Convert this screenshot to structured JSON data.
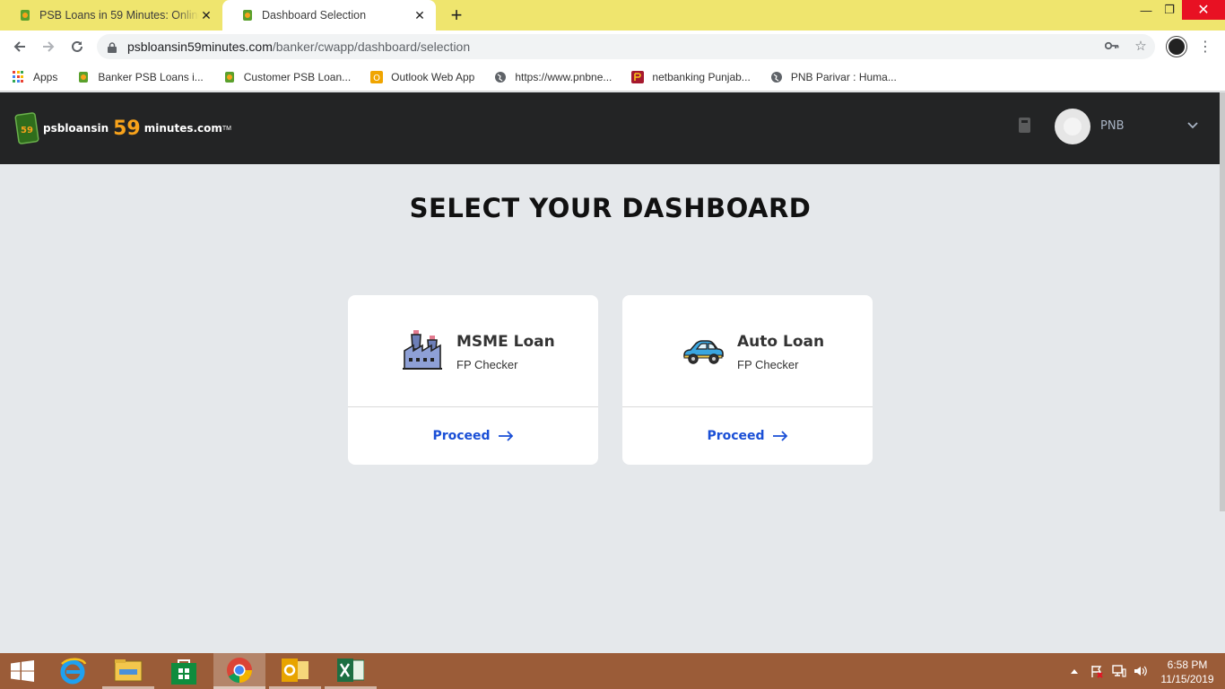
{
  "browser": {
    "tabs": [
      {
        "title": "PSB Loans in 59 Minutes: Online",
        "active": false
      },
      {
        "title": "Dashboard Selection",
        "active": true
      }
    ],
    "new_tab_label": "+",
    "address": {
      "host": "psbloansin59minutes.com",
      "path": "/banker/cwapp/dashboard/selection"
    },
    "bookmarks": [
      {
        "label": "Apps",
        "icon": "apps-grid-icon"
      },
      {
        "label": "Banker PSB Loans i...",
        "icon": "psb-favicon"
      },
      {
        "label": "Customer PSB Loan...",
        "icon": "psb-favicon"
      },
      {
        "label": "Outlook Web App",
        "icon": "outlook-icon"
      },
      {
        "label": "https://www.pnbne...",
        "icon": "globe-icon"
      },
      {
        "label": "netbanking Punjab...",
        "icon": "pnb-icon"
      },
      {
        "label": "PNB Parivar : Huma...",
        "icon": "globe-icon"
      }
    ]
  },
  "site": {
    "brand": {
      "part1": "psbloansin",
      "part2": "59",
      "part3": "minutes.com",
      "tm": "TM"
    },
    "user": {
      "name": "PNB"
    },
    "page_title": "SELECT YOUR DASHBOARD",
    "cards": [
      {
        "title": "MSME Loan",
        "subtitle": "FP Checker",
        "action": "Proceed",
        "icon": "factory-icon"
      },
      {
        "title": "Auto Loan",
        "subtitle": "FP Checker",
        "action": "Proceed",
        "icon": "car-icon"
      }
    ]
  },
  "taskbar": {
    "apps": [
      "internet-explorer-icon",
      "file-explorer-icon",
      "store-icon",
      "chrome-icon",
      "outlook-icon",
      "excel-icon"
    ],
    "clock": {
      "time": "6:58 PM",
      "date": "11/15/2019"
    }
  },
  "colors": {
    "tabstrip": "#efe56e",
    "site_header": "#232425",
    "accent_orange": "#f7a21b",
    "proceed_blue": "#1a4fd6",
    "taskbar": "#9b5c38",
    "page_bg": "#e5e8eb"
  }
}
